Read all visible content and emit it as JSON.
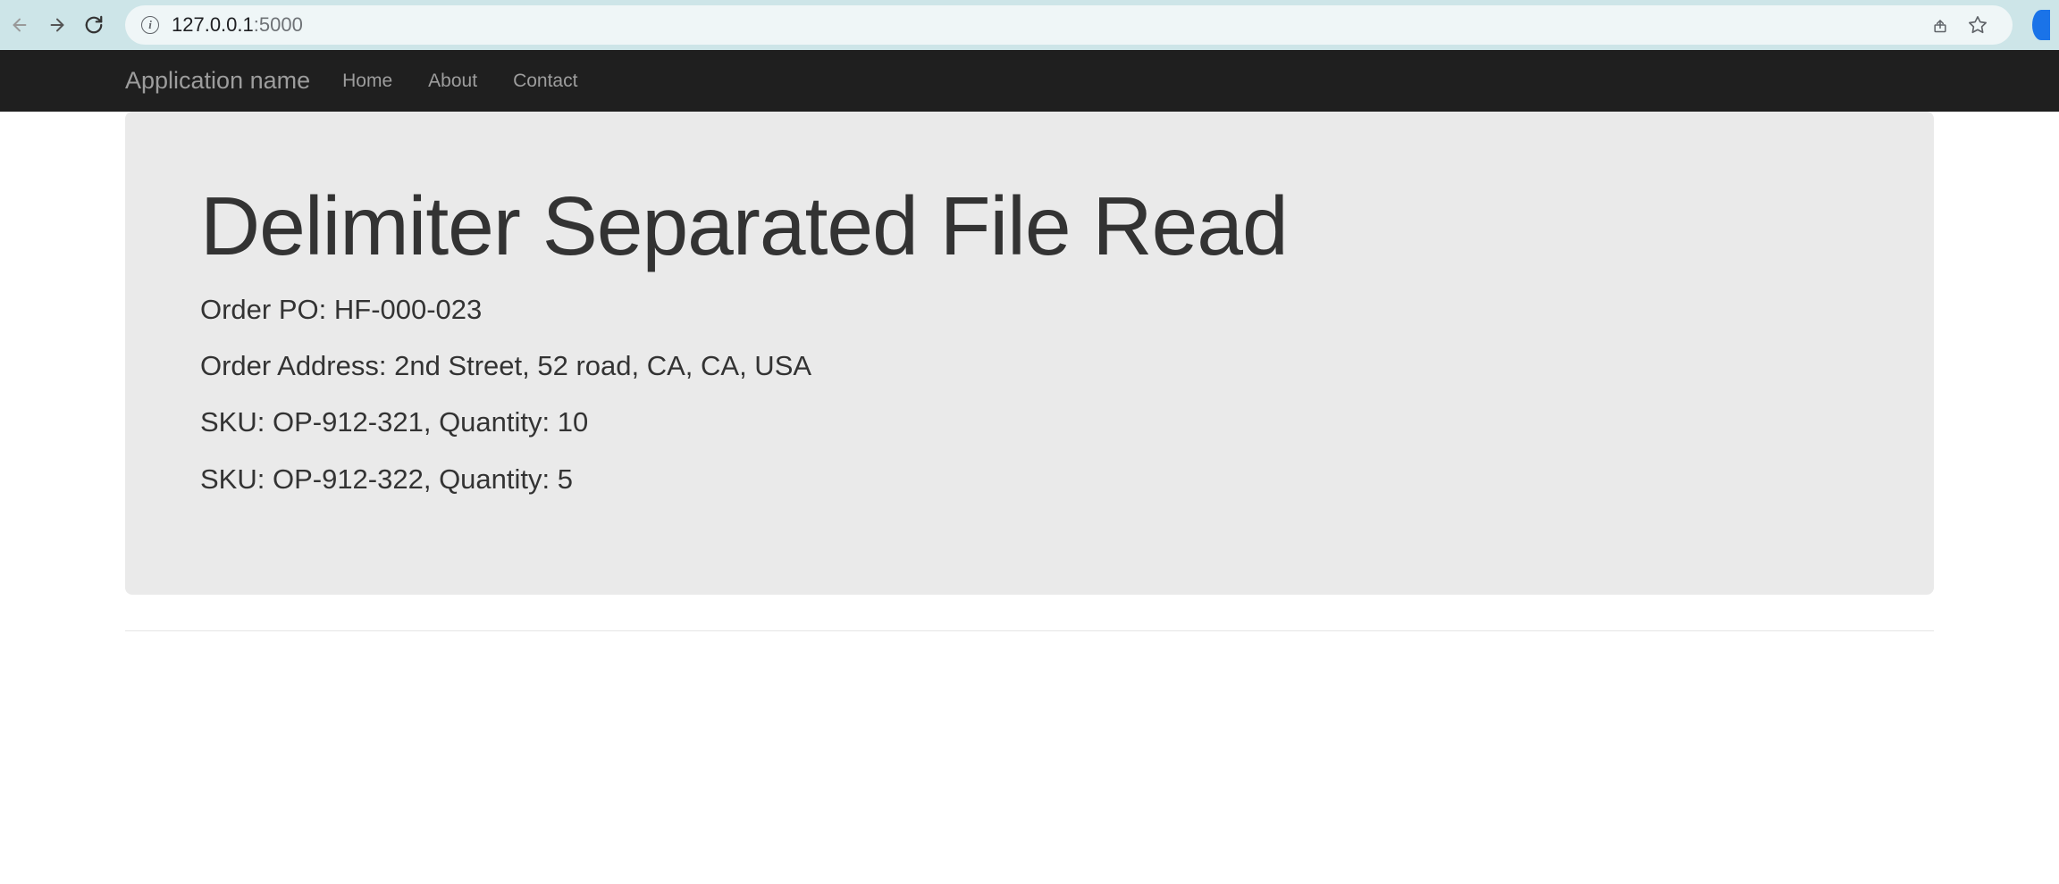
{
  "browser": {
    "url_host": "127.0.0.1",
    "url_port": ":5000"
  },
  "navbar": {
    "brand": "Application name",
    "links": [
      {
        "label": "Home"
      },
      {
        "label": "About"
      },
      {
        "label": "Contact"
      }
    ]
  },
  "jumbotron": {
    "title": "Delimiter Separated File Read",
    "lines": [
      "Order PO: HF-000-023",
      "Order Address: 2nd Street, 52 road, CA, CA, USA",
      "SKU: OP-912-321, Quantity: 10",
      "SKU: OP-912-322, Quantity: 5"
    ]
  }
}
